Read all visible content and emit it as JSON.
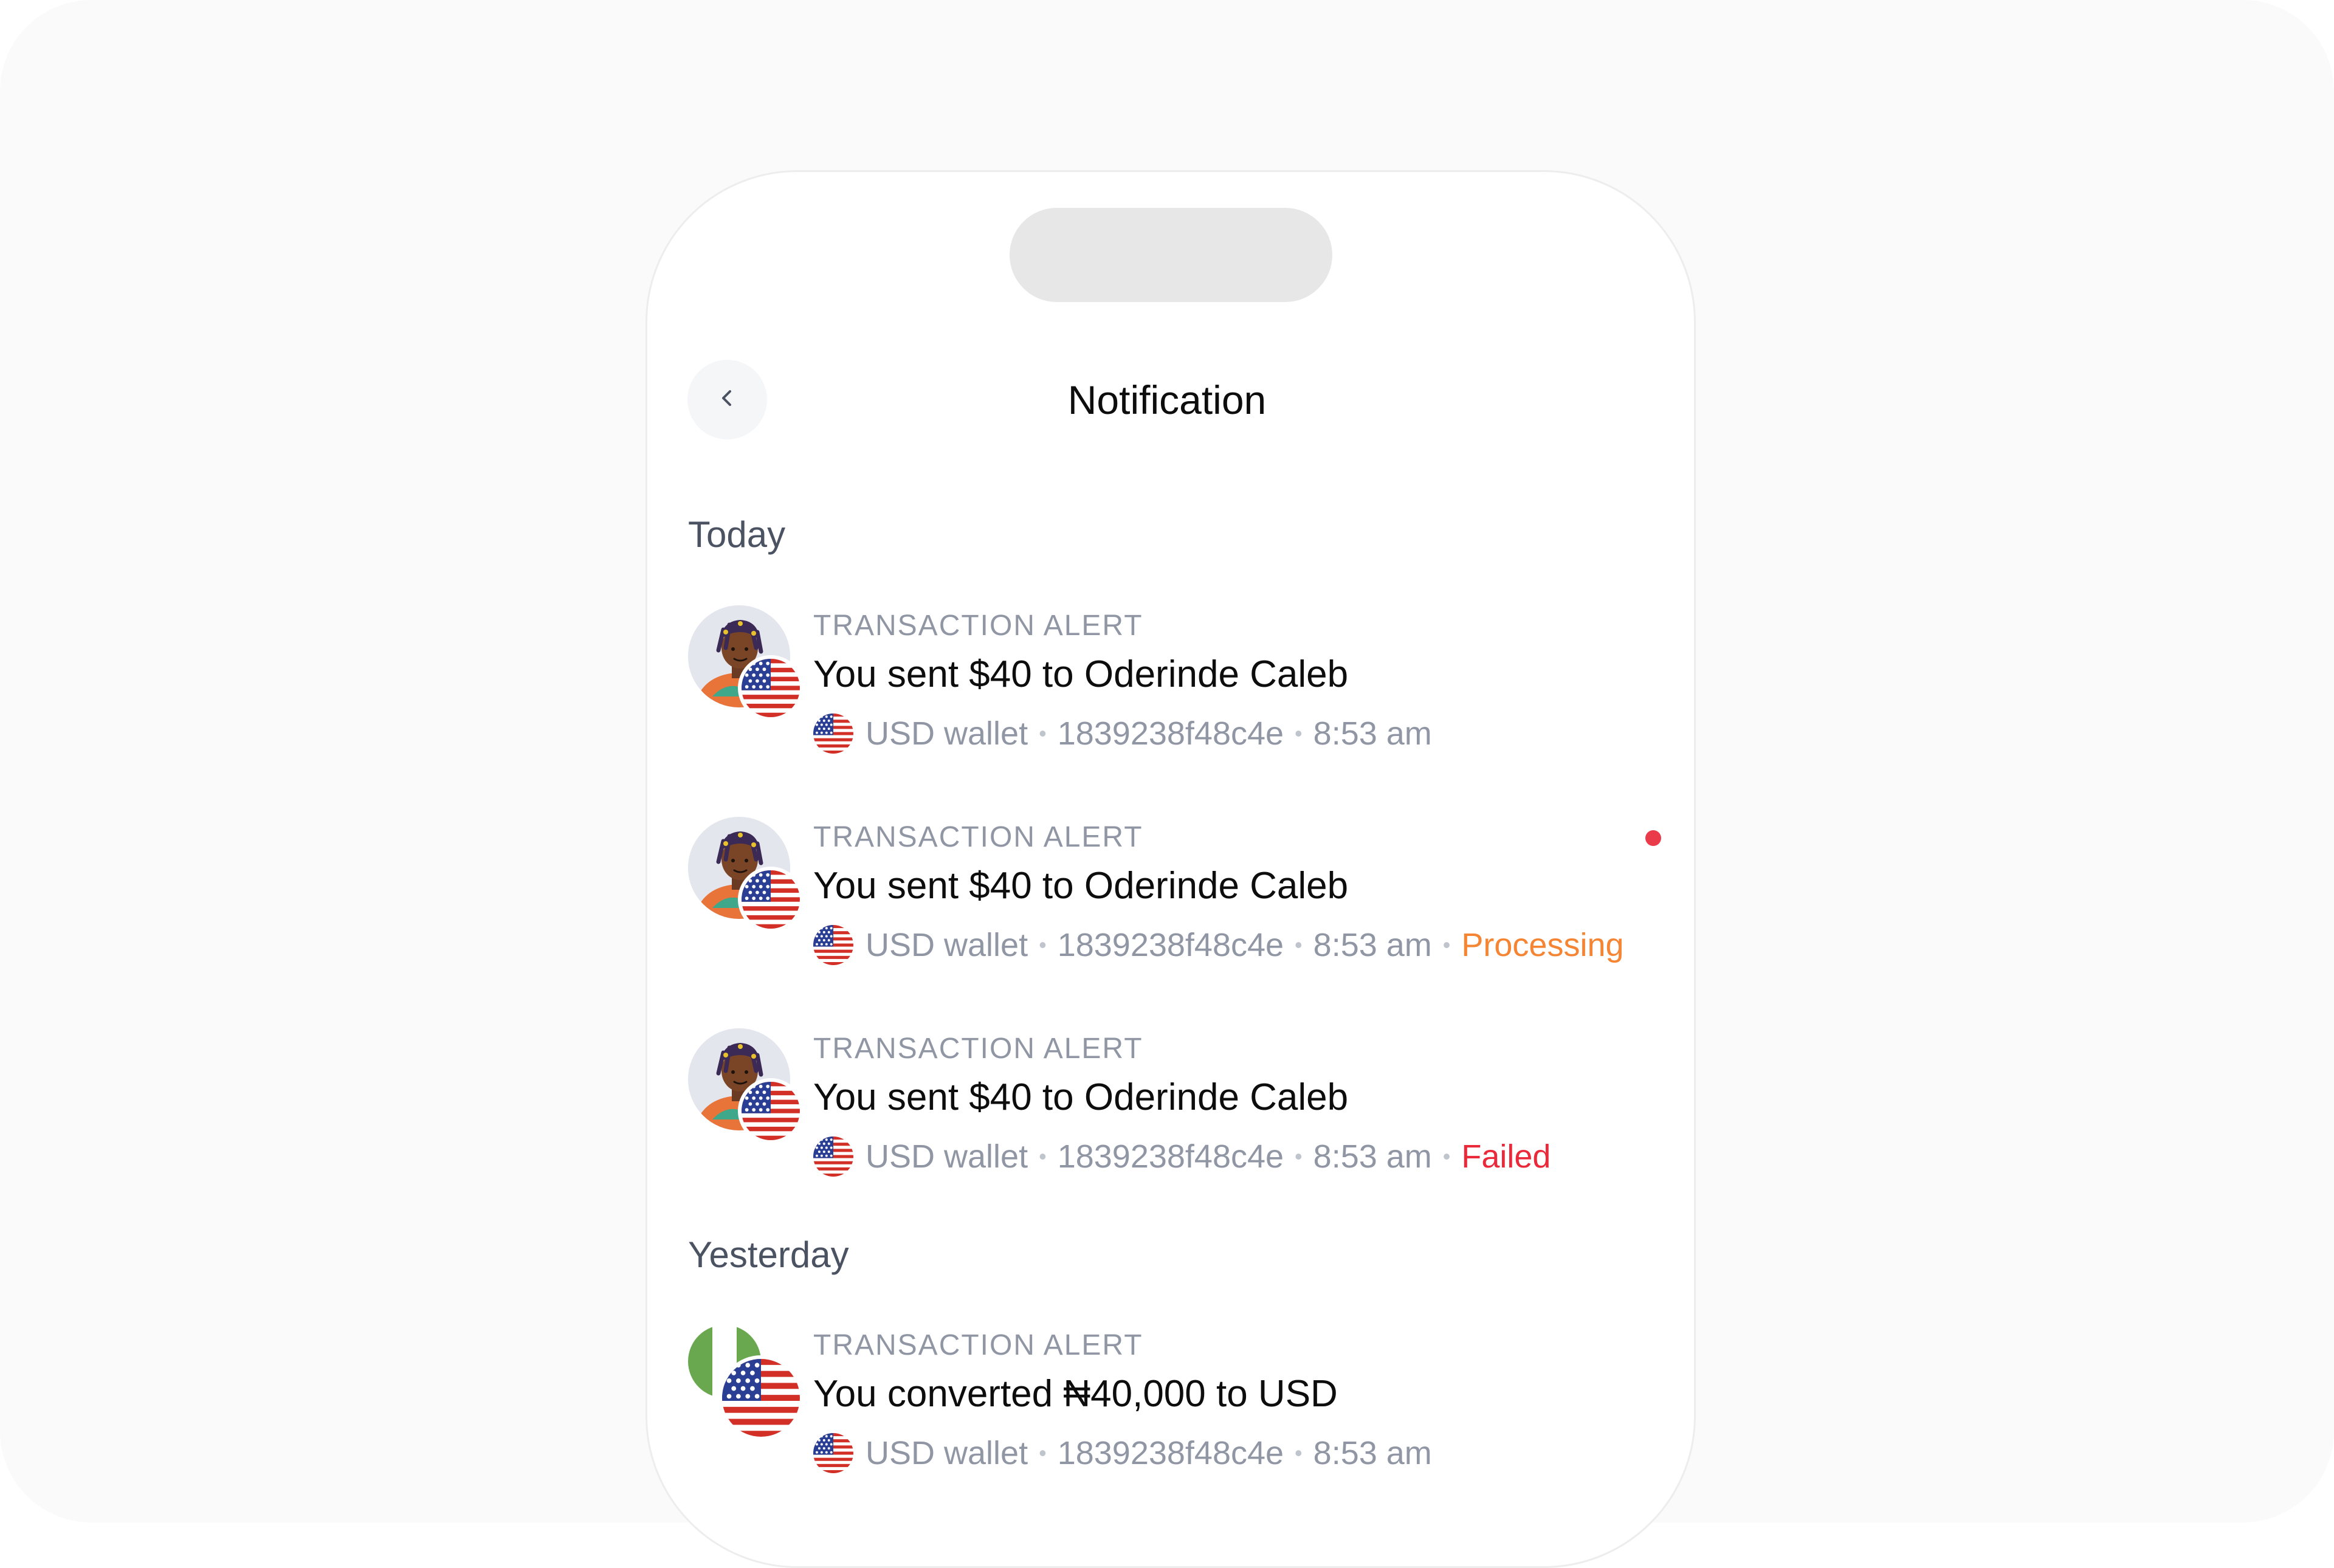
{
  "header": {
    "title": "Notification",
    "back_icon": "chevron-left-icon"
  },
  "sections": [
    {
      "title": "Today"
    },
    {
      "title": "Yesterday"
    }
  ],
  "notifications": [
    {
      "label": "TRANSACTION ALERT",
      "headline": "You sent $40 to Oderinde Caleb",
      "wallet": "USD wallet",
      "reference": "1839238f48c4e",
      "time": "8:53 am",
      "status": "",
      "unread": false
    },
    {
      "label": "TRANSACTION ALERT",
      "headline": "You sent $40 to Oderinde Caleb",
      "wallet": "USD wallet",
      "reference": "1839238f48c4e",
      "time": "8:53 am",
      "status": "Processing",
      "unread": true
    },
    {
      "label": "TRANSACTION ALERT",
      "headline": "You sent $40 to Oderinde Caleb",
      "wallet": "USD wallet",
      "reference": "1839238f48c4e",
      "time": "8:53 am",
      "status": "Failed",
      "unread": false
    },
    {
      "label": "TRANSACTION ALERT",
      "headline": "You converted ₦40,000 to USD",
      "wallet": "USD wallet",
      "reference": "1839238f48c4e",
      "time": "8:53 am",
      "status": "",
      "unread": false
    }
  ],
  "colors": {
    "processing": "#f58433",
    "failed": "#ea2a3b",
    "unread_dot": "#ea3b4a"
  }
}
